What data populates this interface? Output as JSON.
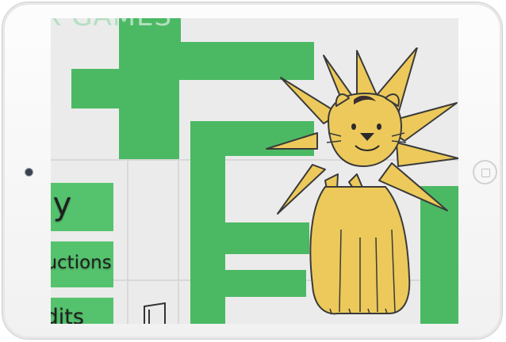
{
  "game": {
    "title": "X GAMES"
  },
  "menu": {
    "play_label": "lay",
    "instructions_label": "ructions",
    "credits_label": "edits"
  },
  "colors": {
    "maze_green": "#4bb963",
    "button_green": "#55c36d",
    "lion_yellow": "#ecc95a",
    "outline": "#3a3a3a"
  },
  "icons": {
    "mascot": "lion-icon",
    "flag": "flag-icon",
    "camera": "camera-icon",
    "home": "home-button"
  }
}
